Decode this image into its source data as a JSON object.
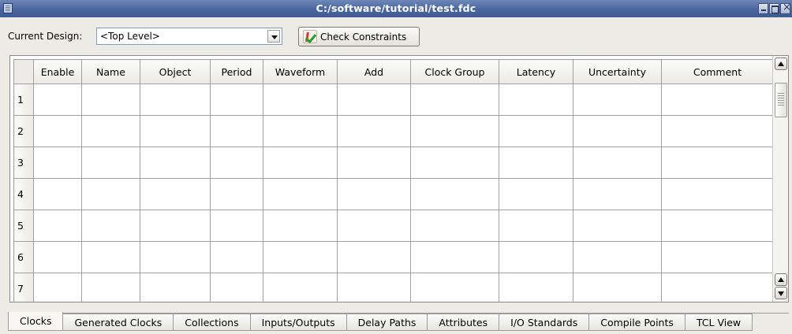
{
  "window": {
    "title": "C:/software/tutorial/test.fdc"
  },
  "toolbar": {
    "current_design_label": "Current Design:",
    "current_design_value": "<Top Level>",
    "check_constraints_label": "Check Constraints"
  },
  "table": {
    "columns": [
      "Enable",
      "Name",
      "Object",
      "Period",
      "Waveform",
      "Add",
      "Clock Group",
      "Latency",
      "Uncertainty",
      "Comment"
    ],
    "rows": [
      "1",
      "2",
      "3",
      "4",
      "5",
      "6",
      "7"
    ]
  },
  "tabs": [
    {
      "label": "Clocks",
      "active": true
    },
    {
      "label": "Generated Clocks",
      "active": false
    },
    {
      "label": "Collections",
      "active": false
    },
    {
      "label": "Inputs/Outputs",
      "active": false
    },
    {
      "label": "Delay Paths",
      "active": false
    },
    {
      "label": "Attributes",
      "active": false
    },
    {
      "label": "I/O Standards",
      "active": false
    },
    {
      "label": "Compile Points",
      "active": false
    },
    {
      "label": "TCL View",
      "active": false
    }
  ],
  "icons": {
    "system_menu": "window-menu-icon",
    "minimize": "minimize-icon",
    "maximize": "maximize-icon",
    "close": "close-icon",
    "dropdown": "chevron-down-icon",
    "check": "check-constraints-icon",
    "scroll_up": "scroll-up-icon",
    "scroll_down": "scroll-down-icon"
  }
}
